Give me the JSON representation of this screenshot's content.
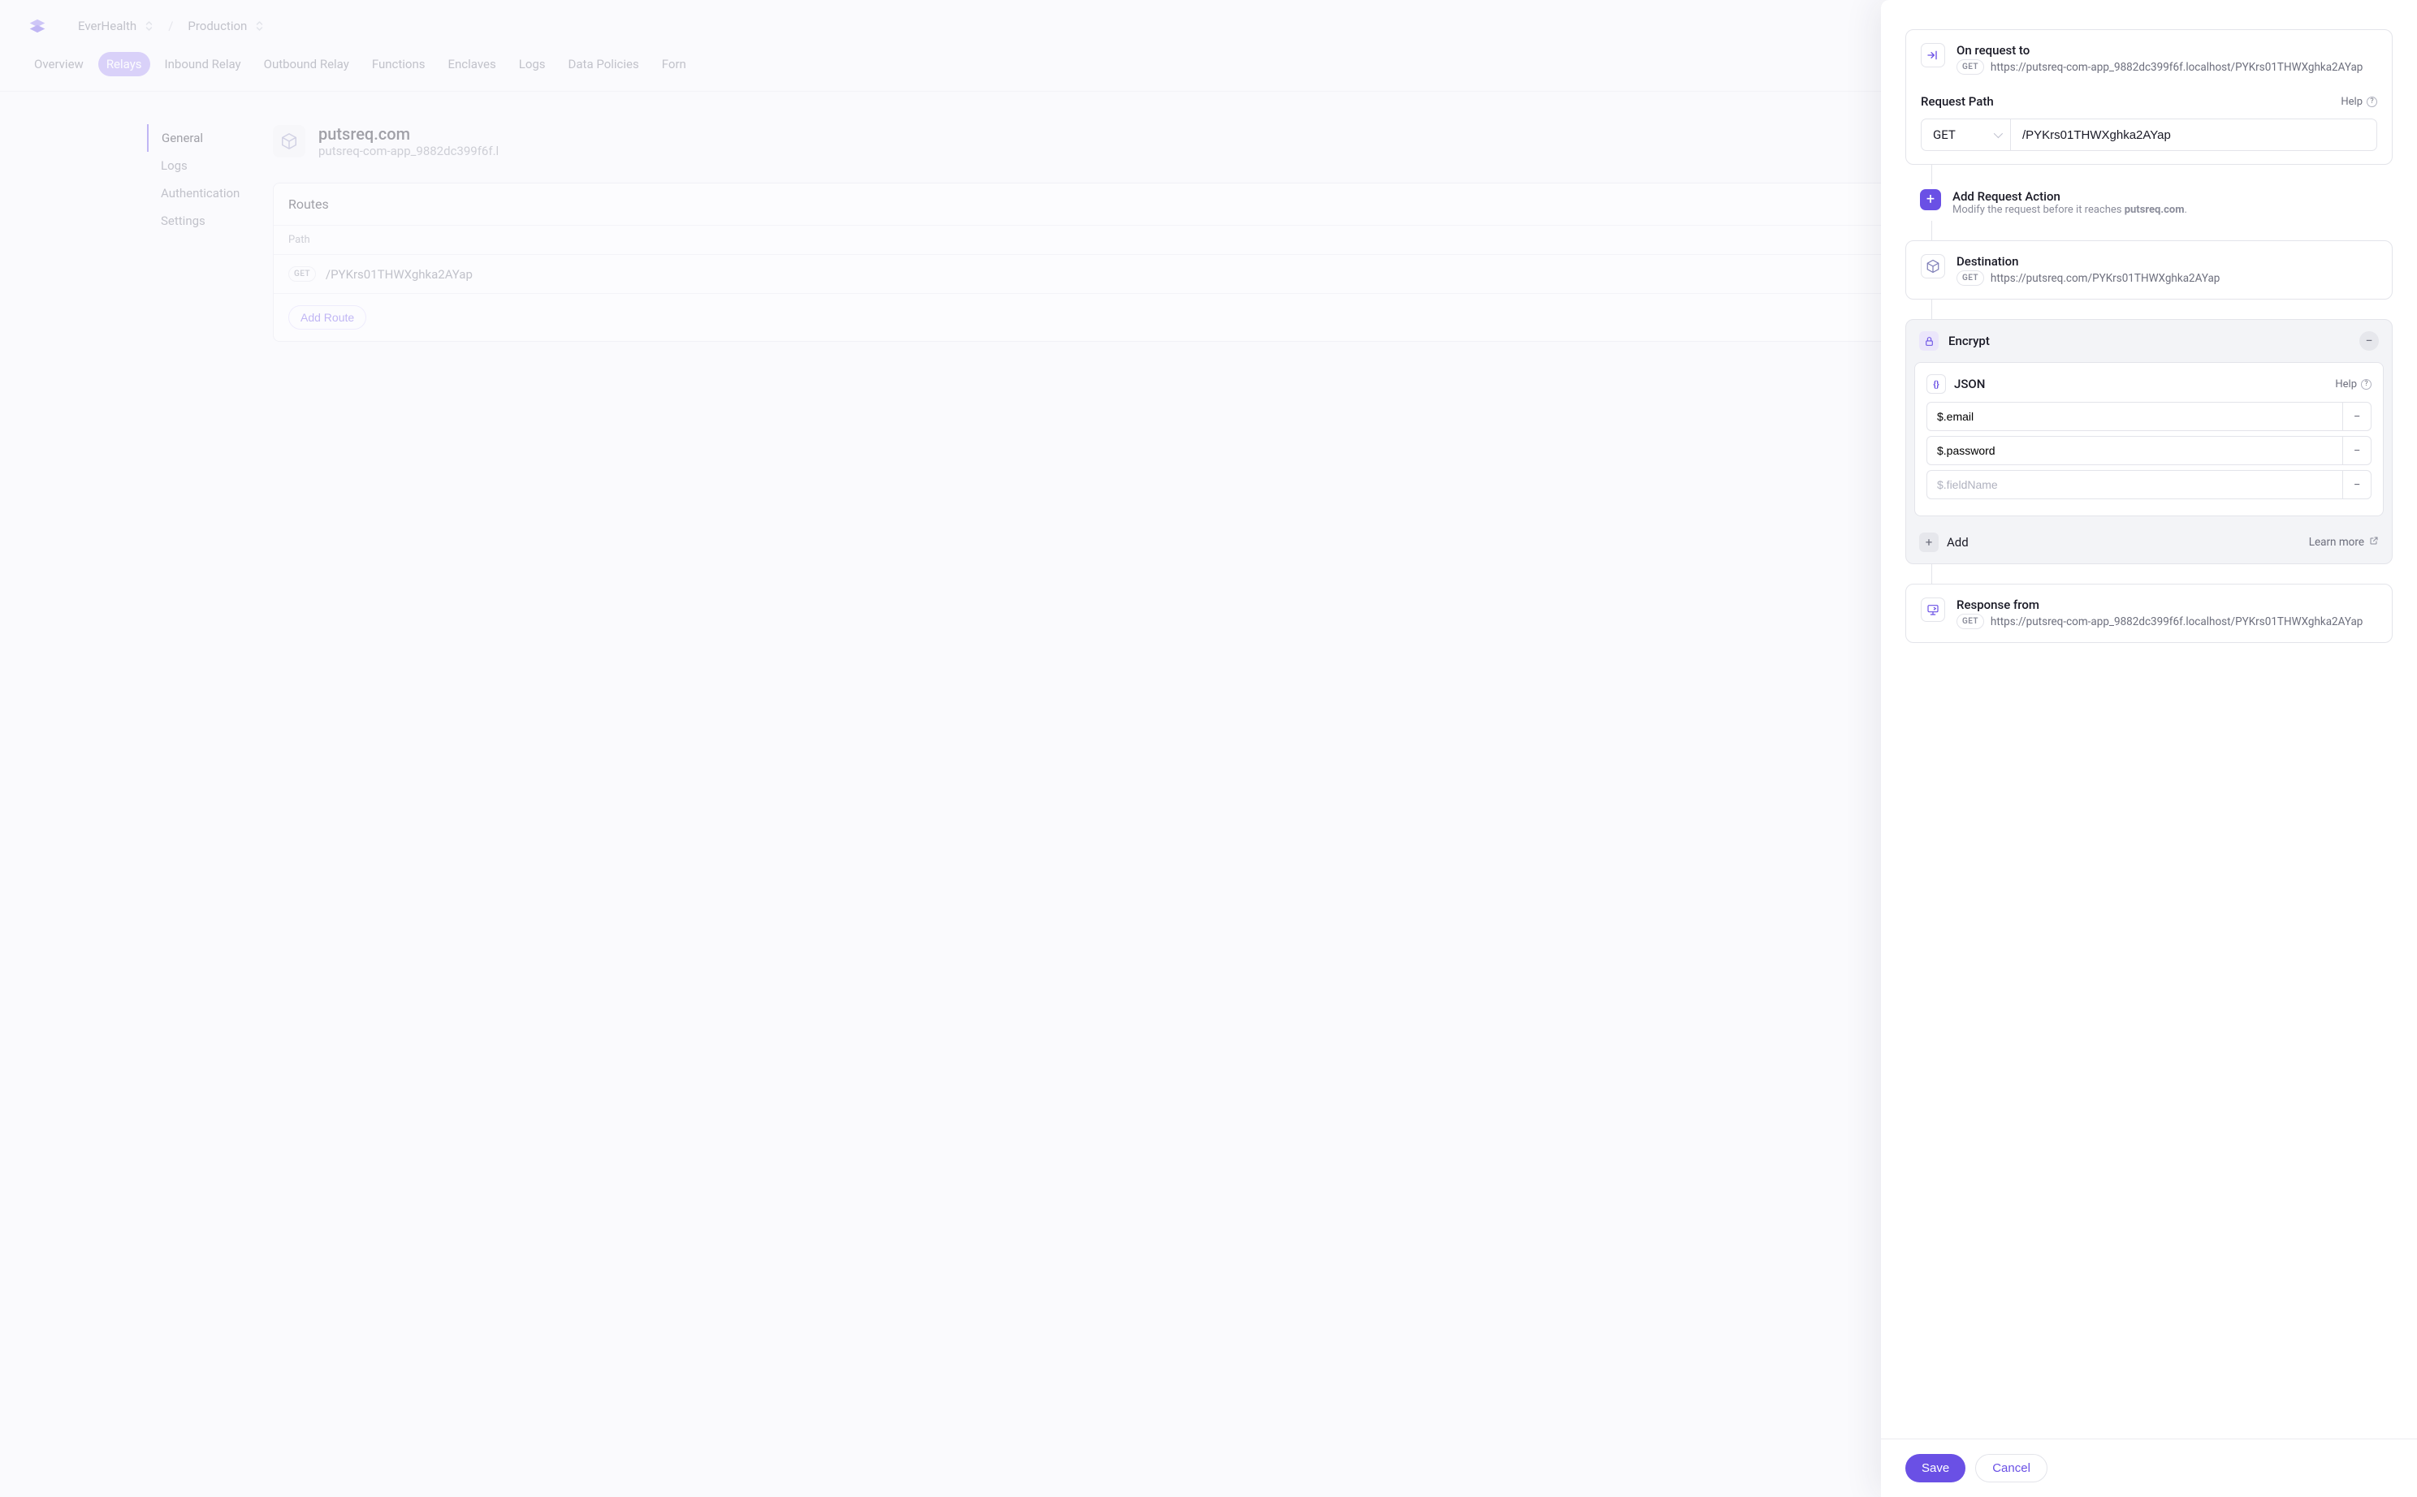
{
  "breadcrumb": {
    "app": "EverHealth",
    "env": "Production"
  },
  "tabs": [
    "Overview",
    "Relays",
    "Inbound Relay",
    "Outbound Relay",
    "Functions",
    "Enclaves",
    "Logs",
    "Data Policies",
    "Forn"
  ],
  "active_tab": "Relays",
  "sidebar": {
    "items": [
      "General",
      "Logs",
      "Authentication",
      "Settings"
    ],
    "active": "General"
  },
  "relay": {
    "title": "putsreq.com",
    "subtitle": "putsreq-com-app_9882dc399f6f.l"
  },
  "routes": {
    "heading": "Routes",
    "path_col": "Path",
    "rows": [
      {
        "method": "GET",
        "path": "/PYKrs01THWXghka2AYap"
      }
    ],
    "add_label": "Add Route"
  },
  "drawer": {
    "on_request_title": "On request to",
    "on_request_method": "GET",
    "on_request_url": "https://putsreq-com-app_9882dc399f6f.localhost/PYKrs01THWXghka2AYap",
    "request_path_heading": "Request Path",
    "help_label": "Help",
    "method": "GET",
    "path_value": "/PYKrs01THWXghka2AYap",
    "add_action_title": "Add Request Action",
    "add_action_sub_prefix": "Modify the request before it reaches ",
    "add_action_sub_dest": "putsreq.com",
    "destination_title": "Destination",
    "destination_method": "GET",
    "destination_url": "https://putsreq.com/PYKrs01THWXghka2AYap",
    "encrypt_title": "Encrypt",
    "json_title": "JSON",
    "fields": [
      {
        "value": "$.email"
      },
      {
        "value": "$.password"
      }
    ],
    "field_placeholder": "$.fieldName",
    "add_label": "Add",
    "learn_more": "Learn more",
    "response_title": "Response from",
    "response_method": "GET",
    "response_url": "https://putsreq-com-app_9882dc399f6f.localhost/PYKrs01THWXghka2AYap",
    "save_label": "Save",
    "cancel_label": "Cancel"
  }
}
